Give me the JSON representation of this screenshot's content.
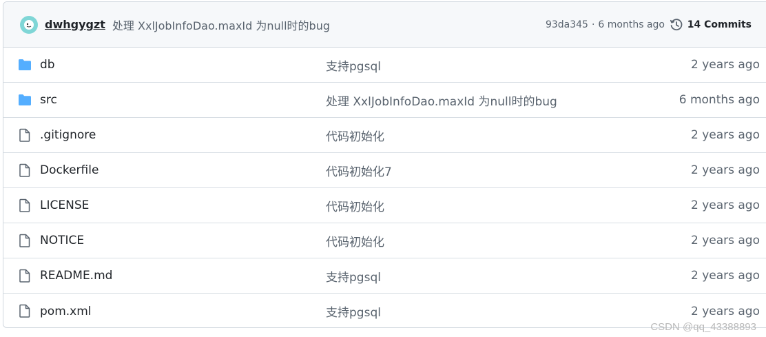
{
  "commit": {
    "author": "dwhgygzt",
    "message": "处理 XxlJobInfoDao.maxId 为null时的bug",
    "sha": "93da345",
    "separator": "·",
    "time": "6 months ago",
    "commits_label": "14 Commits"
  },
  "files": [
    {
      "type": "folder",
      "name": "db",
      "message": "支持pgsql",
      "age": "2 years ago"
    },
    {
      "type": "folder",
      "name": "src",
      "message": "处理 XxlJobInfoDao.maxId 为null时的bug",
      "age": "6 months ago"
    },
    {
      "type": "file",
      "name": ".gitignore",
      "message": "代码初始化",
      "age": "2 years ago"
    },
    {
      "type": "file",
      "name": "Dockerfile",
      "message": "代码初始化7",
      "age": "2 years ago"
    },
    {
      "type": "file",
      "name": "LICENSE",
      "message": "代码初始化",
      "age": "2 years ago"
    },
    {
      "type": "file",
      "name": "NOTICE",
      "message": "代码初始化",
      "age": "2 years ago"
    },
    {
      "type": "file",
      "name": "README.md",
      "message": "支持pgsql",
      "age": "2 years ago"
    },
    {
      "type": "file",
      "name": "pom.xml",
      "message": "支持pgsql",
      "age": "2 years ago"
    }
  ],
  "watermark": "CSDN @qq_43388893",
  "colors": {
    "folder": "#54aeff",
    "file_outline": "#59636e",
    "header_bg": "#f6f8fa",
    "border": "#d0d7de"
  },
  "icons": {
    "folder": "folder-icon",
    "file": "file-icon",
    "history": "history-icon",
    "avatar": "avatar-icon"
  }
}
